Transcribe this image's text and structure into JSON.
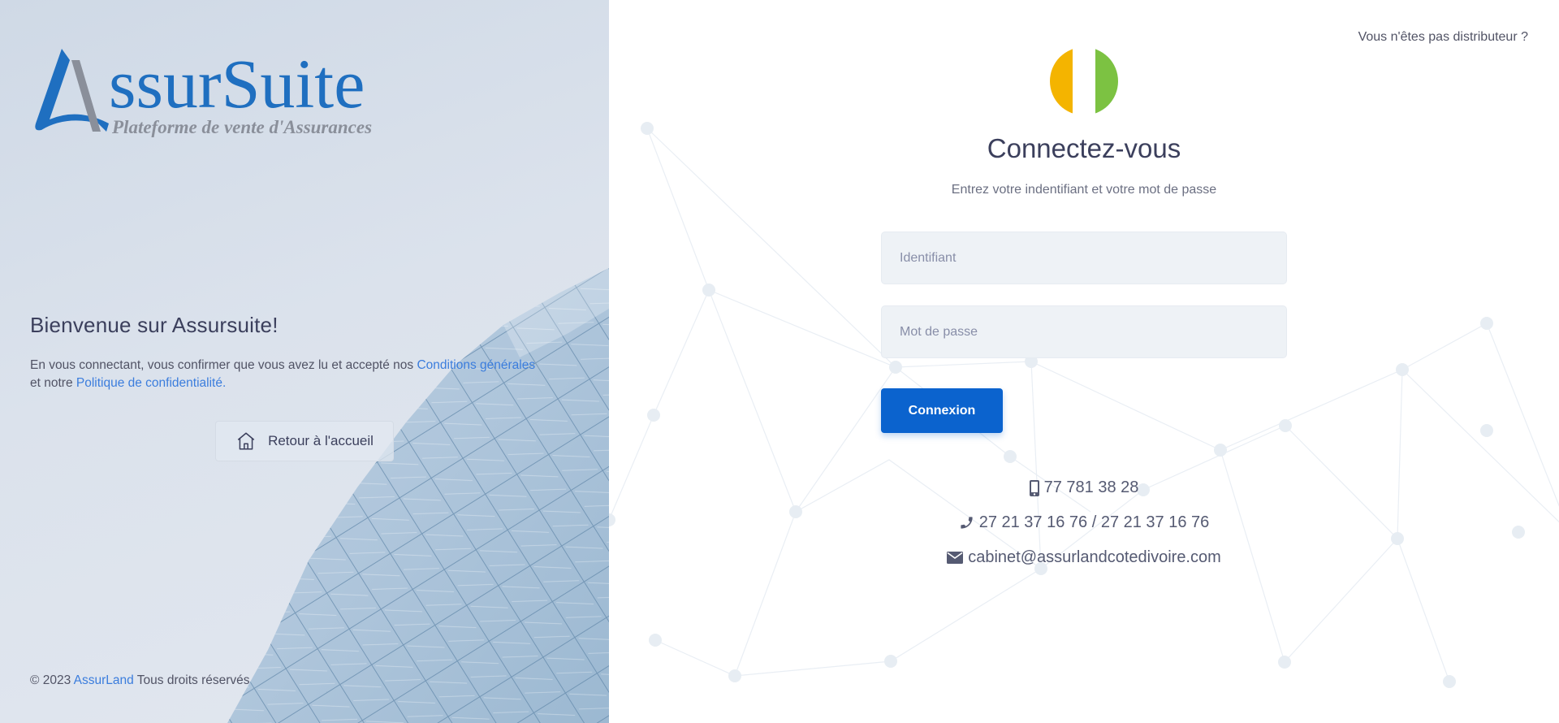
{
  "brand": {
    "logo_main": "AssurSuite",
    "logo_tagline": "Plateforme de vente d'Assurances",
    "colors": {
      "primary": "#0b63ce",
      "logo_blue": "#1f6fc0",
      "logo_grey": "#8a8f9a",
      "link": "#3b7ddd"
    }
  },
  "left": {
    "title": "Bienvenue sur Assursuite!",
    "text_before": "En vous connectant, vous confirmer que vous avez lu et accepté nos ",
    "terms_link": "Conditions générales",
    "text_middle": "et notre ",
    "privacy_link": "Politique de confidentialité.",
    "home_button": {
      "label": "Retour à l'accueil",
      "icon": "home-icon"
    },
    "footer": {
      "copyright": "© 2023 ",
      "company_link": "AssurLand",
      "rights": " Tous droits réservés"
    }
  },
  "right": {
    "not_distributor_link": "Vous n'êtes pas distributeur ?",
    "flag": {
      "name": "cote-divoire-flag",
      "colors": [
        "#f4b400",
        "#ffffff",
        "#7cc242"
      ]
    },
    "title": "Connectez-vous",
    "subtitle": "Entrez votre indentifiant et votre mot de passe",
    "form": {
      "username_placeholder": "Identifiant",
      "username_value": "",
      "password_placeholder": "Mot de passe",
      "password_value": "",
      "submit_label": "Connexion"
    },
    "contacts": {
      "mobile": "77 781 38 28",
      "phone": "27 21 37 16 76 / 27 21 37 16 76",
      "email": "cabinet@assurlandcotedivoire.com"
    }
  }
}
